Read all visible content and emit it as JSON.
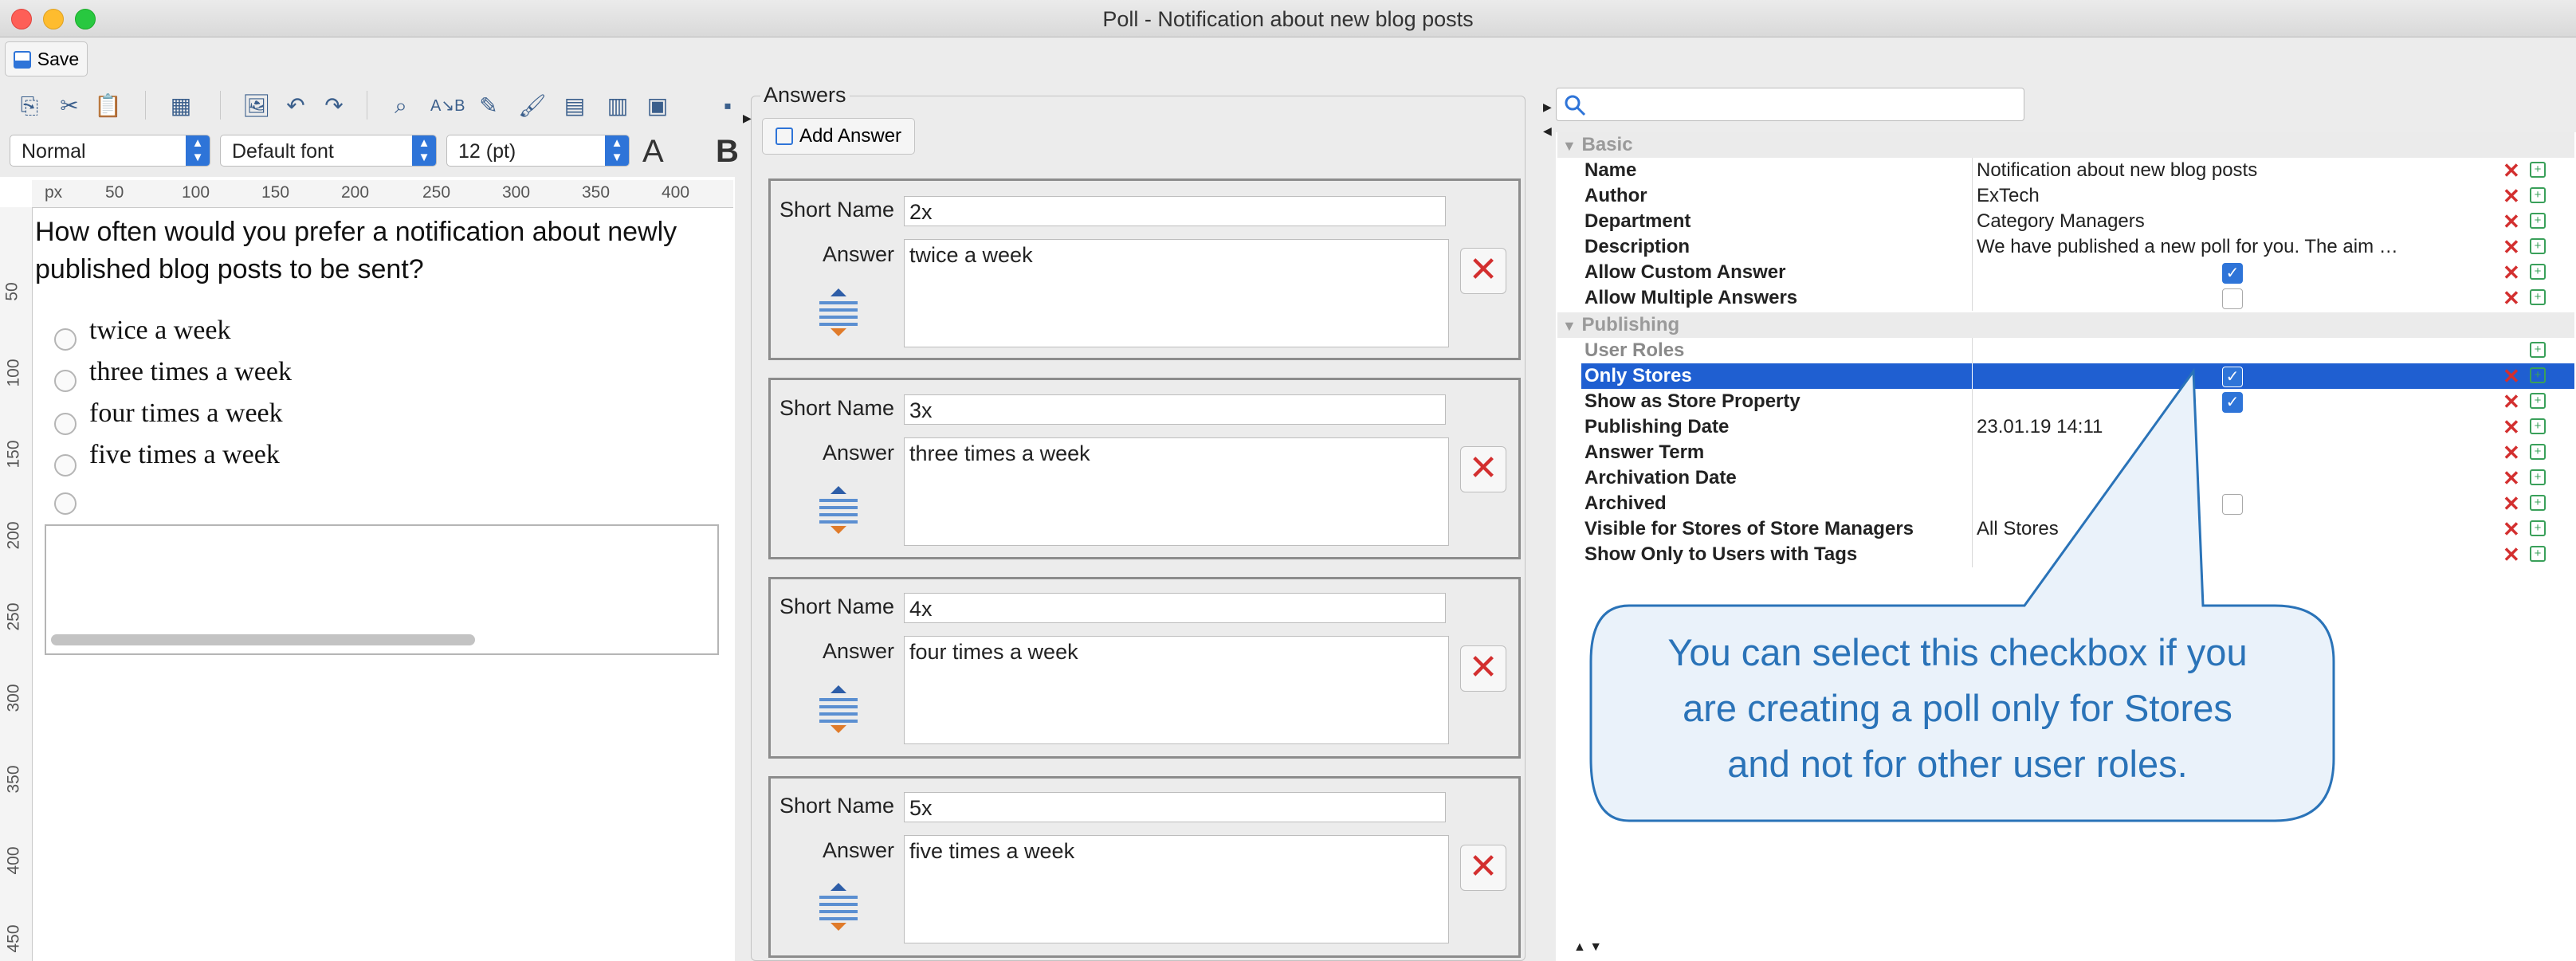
{
  "window": {
    "title": "Poll - Notification about new blog posts"
  },
  "toolbar": {
    "save_label": "Save",
    "style_value": "Normal",
    "font_value": "Default font",
    "size_value": "12 (pt)",
    "bold_char": "B",
    "font_color_char": "A"
  },
  "editor": {
    "ruler_unit": "px",
    "ruler_h": [
      "50",
      "100",
      "150",
      "200",
      "250",
      "300",
      "350",
      "400"
    ],
    "ruler_v": [
      "50",
      "100",
      "150",
      "200",
      "250",
      "300",
      "350",
      "400",
      "450"
    ],
    "question": "How often would you prefer a notification about newly published blog posts to be sent?",
    "options": [
      "twice a week",
      "three times a week",
      "four times a week",
      "five times a week"
    ]
  },
  "answers": {
    "title": "Answers",
    "add_label": "Add Answer",
    "short_name_label": "Short Name",
    "answer_label": "Answer",
    "items": [
      {
        "short_name": "2x",
        "answer": "twice a week"
      },
      {
        "short_name": "3x",
        "answer": "three times a week"
      },
      {
        "short_name": "4x",
        "answer": "four times a week"
      },
      {
        "short_name": "5x",
        "answer": "five times a week"
      }
    ]
  },
  "properties": {
    "sections": [
      "Basic",
      "Publishing"
    ],
    "rows": [
      {
        "name": "Name",
        "value": "Notification about new blog posts"
      },
      {
        "name": "Author",
        "value": "ExTech"
      },
      {
        "name": "Department",
        "value": "Category Managers"
      },
      {
        "name": "Description",
        "value": "We have published a new poll for you. The aim of this..."
      },
      {
        "name": "Allow Custom Answer",
        "value": "",
        "checked": true
      },
      {
        "name": "Allow Multiple Answers",
        "value": "",
        "checked": false
      },
      {
        "name": "User Roles",
        "value": ""
      },
      {
        "name": "Only Stores",
        "value": "",
        "checked": true
      },
      {
        "name": "Show as Store Property",
        "value": "",
        "checked": true
      },
      {
        "name": "Publishing Date",
        "value": "23.01.19 14:11"
      },
      {
        "name": "Answer Term",
        "value": ""
      },
      {
        "name": "Archivation Date",
        "value": ""
      },
      {
        "name": "Archived",
        "value": "",
        "checked": false
      },
      {
        "name": "Visible for Stores of Store Managers",
        "value": "All Stores"
      },
      {
        "name": "Show Only to Users with Tags",
        "value": ""
      }
    ]
  },
  "callout": {
    "line1": "You can select this checkbox if you",
    "line2": "are creating a poll only for Stores",
    "line3": "and not for other user roles."
  },
  "colors": {
    "accent": "#2e74d8",
    "selection": "#1f5fd1",
    "callout_text": "#2a73b8",
    "delete": "#d32f2f"
  }
}
